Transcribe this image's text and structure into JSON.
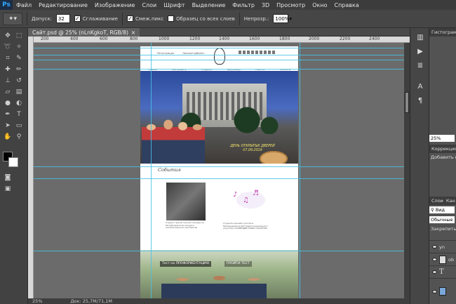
{
  "menubar": {
    "logo": "Ps",
    "items": [
      "Файл",
      "Редактирование",
      "Изображение",
      "Слои",
      "Шрифт",
      "Выделение",
      "Фильтр",
      "3D",
      "Просмотр",
      "Окно",
      "Справка"
    ]
  },
  "options": {
    "tolerance_label": "Допуск:",
    "tolerance_value": "32",
    "antialias_label": "Сглаживание",
    "contiguous_label": "Смеж.пикс",
    "sample_all_label": "Образец со всех слоев",
    "opacity_label": "Непрозр.:",
    "opacity_value": "100%"
  },
  "document": {
    "tab_title": "Сайт.psd @ 25% (nLnKgkoT, RGB/8)",
    "tab_close": "×",
    "zoom": "25%",
    "doc_size": "Док: 25,7M/71,1M"
  },
  "ruler": {
    "h_ticks": [
      "200",
      "400",
      "600",
      "800",
      "1000",
      "1200",
      "1400",
      "1600",
      "1800",
      "2000",
      "2200",
      "2400"
    ]
  },
  "site": {
    "top_left": "Регистрация",
    "top_mid": "Личный кабинет",
    "nav": [
      "Главная",
      "Абитуриенту",
      "Студенту",
      "Выпускнику",
      "Новости",
      "Контакты"
    ],
    "open_day": "ДЕНЬ ОТКРЫТЫХ ДВЕРЕЙ",
    "open_day_date": "07.09.2019",
    "events_title": "События",
    "caption1": "Студент группы получил награду на Республиканском конкурсе исполнительского мастерства",
    "caption2": "Студенты приняли участие в Международном фестивале музыкального искусства «СОЗВЕЗДИЕ ЮНЫХ ТАЛАНТОВ»",
    "test_label": "Тест на ПРОФОРИЕНТАЦИЮ",
    "test_button": "ПРОЙТИ ТЕСТ"
  },
  "panels": {
    "histogram": "Гистограмма",
    "zoom_small": "25%",
    "correction": "Коррекция",
    "add_correction": "Добавить к",
    "layers_tab": "Слои",
    "channels_tab": "Кан",
    "search_kind": "Вид",
    "blend_mode": "Обычные",
    "lock_label": "Закрепить:",
    "layer_names": [
      "yn",
      "ob",
      "T",
      ""
    ]
  },
  "colors": {
    "accent_guides": "#47c2e6",
    "app_bg": "#535353",
    "menubar": "#3c3c3c"
  }
}
